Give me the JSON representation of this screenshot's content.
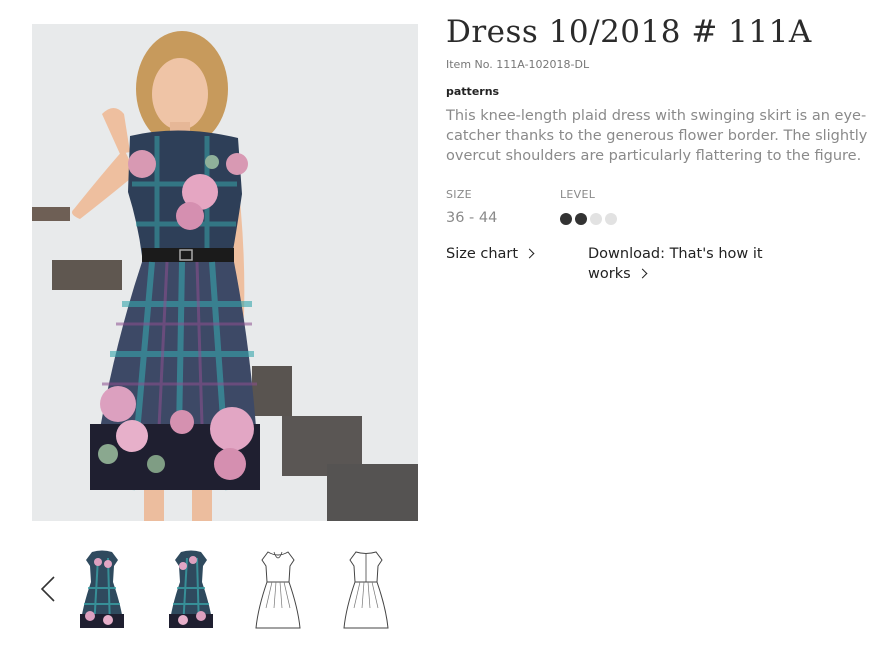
{
  "product": {
    "title": "Dress 10/2018 # 111A",
    "item_no": "Item No. 111A-102018-DL",
    "category": "patterns",
    "description": "This knee-length plaid dress with swinging skirt is an eye-catcher thanks to the generous flower border. The slightly overcut shoulders are particularly flattering to the figure."
  },
  "specs": {
    "size_label": "SIZE",
    "size_value": "36 - 44",
    "level_label": "LEVEL",
    "level_value": 2,
    "level_max": 4
  },
  "links": {
    "size_chart": "Size chart",
    "download": "Download: That's how it works"
  },
  "gallery": {
    "thumbnails": [
      {
        "icon": "dress-photo-front-thumbnail"
      },
      {
        "icon": "dress-photo-back-thumbnail"
      },
      {
        "icon": "dress-technical-drawing-front-thumbnail"
      },
      {
        "icon": "dress-technical-drawing-back-thumbnail"
      }
    ]
  },
  "colors": {
    "title": "#2b2b2b",
    "body_text": "#8a8a8a",
    "level_filled": "#333333",
    "level_empty": "#e2e2e2"
  }
}
